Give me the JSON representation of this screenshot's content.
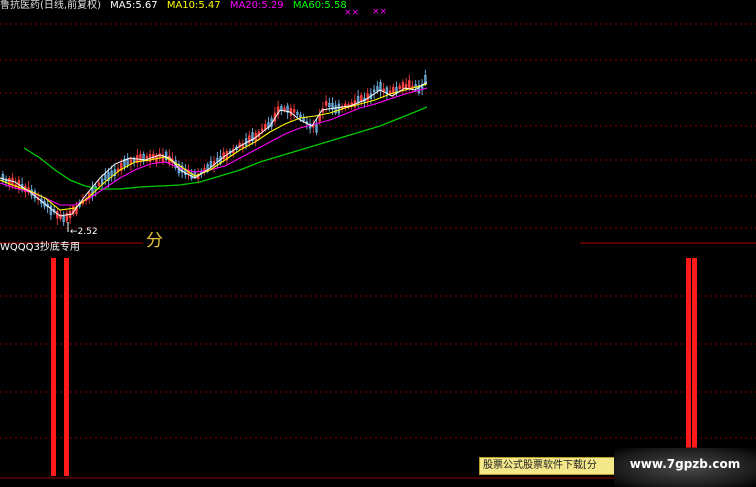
{
  "header": {
    "stock_title": "鲁抗医药(日线,前复权)",
    "ma5": "MA5:5.67",
    "ma10": "MA10:5.47",
    "ma20": "MA20:5.29",
    "ma60": "MA60:5.58"
  },
  "markers": [
    "××",
    "××"
  ],
  "annotations": {
    "low_price": "←2.52",
    "watermark_partial": "分",
    "indicator_name": "WQQQ3抄底专用"
  },
  "ad_banner": "股票公式股票软件下载[分",
  "site_badge": "www.7gpzb.com",
  "colors": {
    "background": "#000000",
    "up_candle": "#7ec8ff",
    "down_candle": "#ff4040",
    "ma5": "#ffffff",
    "ma10": "#ffff00",
    "ma20": "#ff00ff",
    "ma60": "#00cc00",
    "signal_bar": "#ff1a1a",
    "grid": "#8b0000"
  },
  "indicator_signals": [
    {
      "position": "left",
      "count": 2,
      "level": 1.0
    },
    {
      "position": "right",
      "count": 2,
      "level": 0.87
    }
  ]
}
